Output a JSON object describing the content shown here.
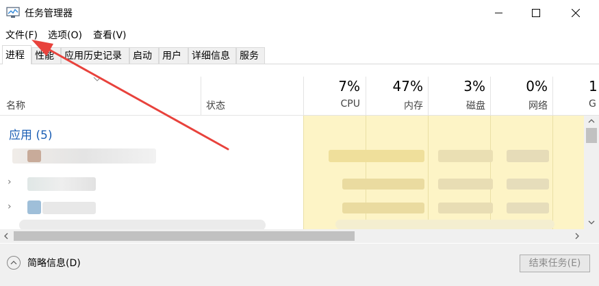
{
  "window": {
    "title": "任务管理器"
  },
  "menu": [
    "文件(F)",
    "选项(O)",
    "查看(V)"
  ],
  "tabs": [
    "进程",
    "性能",
    "应用历史记录",
    "启动",
    "用户",
    "详细信息",
    "服务"
  ],
  "columns": {
    "name": "名称",
    "status": "状态",
    "cpu": {
      "pct": "7%",
      "label": "CPU"
    },
    "memory": {
      "pct": "47%",
      "label": "内存"
    },
    "disk": {
      "pct": "3%",
      "label": "磁盘"
    },
    "network": {
      "pct": "0%",
      "label": "网络"
    },
    "gpu": {
      "pct": "1",
      "label": "G"
    }
  },
  "groups": {
    "apps": "应用 (5)"
  },
  "footer": {
    "fewer_details": "简略信息(D)",
    "end_task": "结束任务(E)"
  },
  "colors": {
    "accent": "#1c5fb5",
    "usage_highlight": "#fdf4c6",
    "arrow": "#e8423c"
  }
}
